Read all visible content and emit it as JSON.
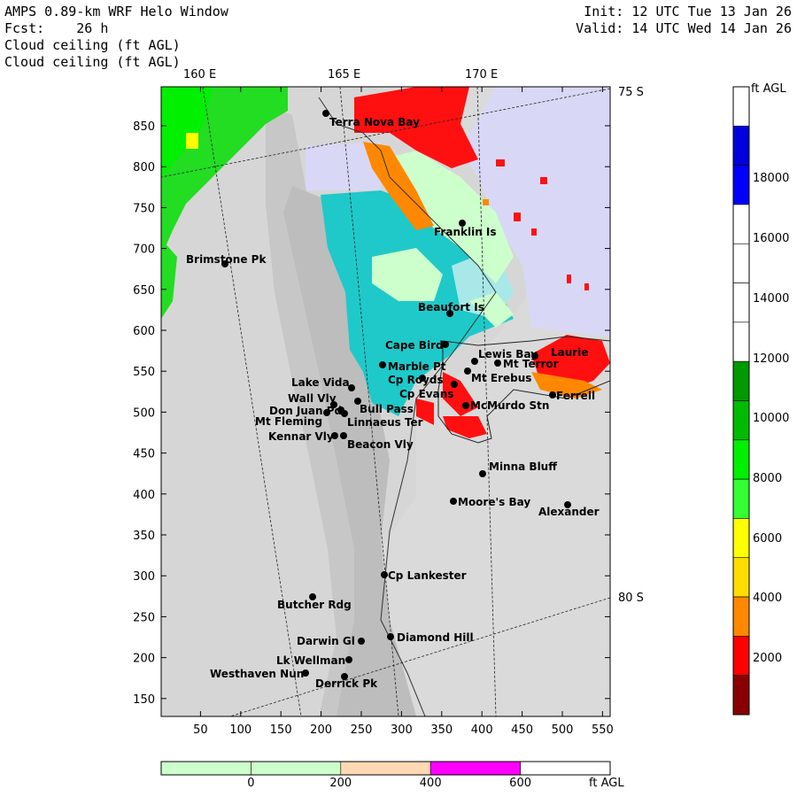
{
  "header": {
    "title": "AMPS 0.89-km WRF Helo Window",
    "forecast": "Fcst:    26 h",
    "field_1": "Cloud ceiling (ft AGL)",
    "field_2": "Cloud ceiling (ft AGL)",
    "init": "Init: 12 UTC Tue 13 Jan 26",
    "valid": "Valid: 14 UTC Wed 14 Jan 26"
  },
  "map": {
    "lon_labels": [
      "160 E",
      "165 E",
      "170 E"
    ],
    "lat_labels": [
      "75 S",
      "80 S"
    ],
    "x_ticks": [
      "50",
      "100",
      "150",
      "200",
      "250",
      "300",
      "350",
      "400",
      "450",
      "500",
      "550"
    ],
    "y_ticks": [
      "850",
      "800",
      "750",
      "700",
      "650",
      "600",
      "550",
      "500",
      "450",
      "400",
      "350",
      "300",
      "250",
      "200",
      "150"
    ],
    "stations": [
      {
        "name": "Terra Nova Bay"
      },
      {
        "name": "Franklin Is"
      },
      {
        "name": "Brimstone Pk"
      },
      {
        "name": "Beaufort Is"
      },
      {
        "name": "Cape Bird"
      },
      {
        "name": "Lewis Bay"
      },
      {
        "name": "Laurie"
      },
      {
        "name": "Marble Pt"
      },
      {
        "name": "Mt Terror"
      },
      {
        "name": "Cp Royds"
      },
      {
        "name": "Mt Erebus"
      },
      {
        "name": "Lake Vida"
      },
      {
        "name": "Cp Evans"
      },
      {
        "name": "Ferrell"
      },
      {
        "name": "Wall Vly"
      },
      {
        "name": "Bull Pass"
      },
      {
        "name": "McMurdo Stn"
      },
      {
        "name": "Don Juan Pd"
      },
      {
        "name": "Mt Fleming"
      },
      {
        "name": "Linnaeus Ter"
      },
      {
        "name": "Kennar Vly"
      },
      {
        "name": "Beacon Vly"
      },
      {
        "name": "Minna Bluff"
      },
      {
        "name": "Moore's Bay"
      },
      {
        "name": "Alexander"
      },
      {
        "name": "Cp Lankester"
      },
      {
        "name": "Butcher Rdg"
      },
      {
        "name": "Darwin Gl"
      },
      {
        "name": "Diamond Hill"
      },
      {
        "name": "Lk Wellman"
      },
      {
        "name": "Westhaven Nun"
      },
      {
        "name": "Derrick Pk"
      }
    ]
  },
  "colorbar_right": {
    "unit": "ft AGL",
    "labels": [
      "18000",
      "16000",
      "14000",
      "12000",
      "10000",
      "8000",
      "6000",
      "4000",
      "2000"
    ],
    "colors": [
      "#ffffff",
      "#0000dd",
      "#0000ff",
      "#ffffff",
      "#ffffff",
      "#ffffff",
      "#ffffff",
      "#009900",
      "#00bb00",
      "#00ee00",
      "#33ff33",
      "#ffff00",
      "#ffdd00",
      "#ff8800",
      "#ff0000",
      "#880000"
    ]
  },
  "colorbar_bottom": {
    "unit": "ft AGL",
    "labels": [
      "0",
      "200",
      "400",
      "600"
    ],
    "colors": [
      "#ccffcc",
      "#ccffcc",
      "#ffd9b3",
      "#ff00ff",
      "#ffffff"
    ]
  }
}
